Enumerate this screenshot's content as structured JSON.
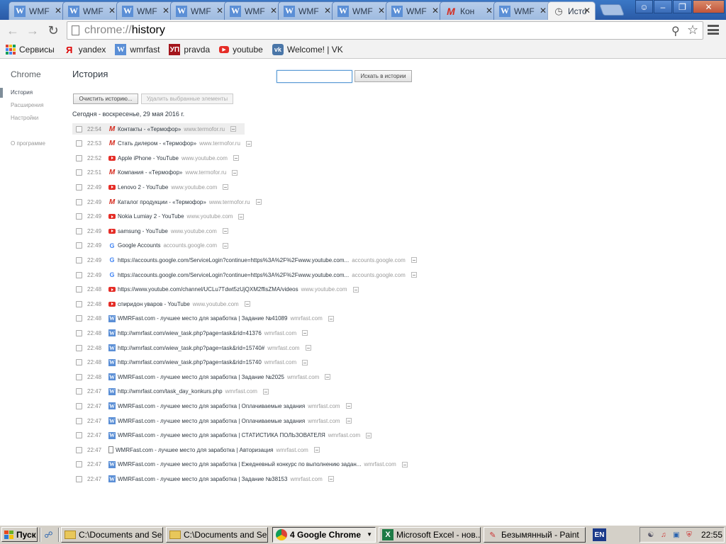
{
  "tabs": [
    {
      "title": "WMF",
      "icon": "wmrfast-favicon"
    },
    {
      "title": "WMF",
      "icon": "wmrfast-favicon"
    },
    {
      "title": "WMF",
      "icon": "wmrfast-favicon"
    },
    {
      "title": "WMF",
      "icon": "wmrfast-favicon"
    },
    {
      "title": "WMF",
      "icon": "wmrfast-favicon"
    },
    {
      "title": "WMF",
      "icon": "wmrfast-favicon"
    },
    {
      "title": "WMF",
      "icon": "wmrfast-favicon"
    },
    {
      "title": "WMF",
      "icon": "wmrfast-favicon"
    },
    {
      "title": "Кон",
      "icon": "termofor-favicon"
    },
    {
      "title": "WMF",
      "icon": "wmrfast-favicon"
    },
    {
      "title": "Исто",
      "icon": "history-clock-icon",
      "active": true
    }
  ],
  "omnibox": {
    "scheme": "chrome://",
    "host": "history"
  },
  "bookmarks": [
    {
      "label": "Сервисы",
      "icon": "apps-icon"
    },
    {
      "label": "yandex",
      "icon": "yandex-icon"
    },
    {
      "label": "wmrfast",
      "icon": "wmrfast-icon"
    },
    {
      "label": "pravda",
      "icon": "pravda-icon"
    },
    {
      "label": "youtube",
      "icon": "youtube-icon"
    },
    {
      "label": "Welcome! | VK",
      "icon": "vk-icon"
    }
  ],
  "sidebar": {
    "title": "Chrome",
    "items": [
      {
        "label": "История"
      },
      {
        "label": "Расширения"
      },
      {
        "label": "Настройки"
      },
      {
        "label": "О программе"
      }
    ]
  },
  "history": {
    "title": "История",
    "search_button": "Искать в истории",
    "clear_button": "Очистить историю...",
    "remove_button": "Удалить выбранные элементы",
    "day_header": "Сегодня - воскресенье, 29 мая 2016 г.",
    "entries": [
      {
        "time": "22:54",
        "icon": "termofor",
        "title": "Контакты - «Термофор»",
        "domain": "www.termofor.ru"
      },
      {
        "time": "22:53",
        "icon": "termofor",
        "title": "Стать дилером - «Термофор»",
        "domain": "www.termofor.ru"
      },
      {
        "time": "22:52",
        "icon": "youtube",
        "title": "Apple iPhone - YouTube",
        "domain": "www.youtube.com"
      },
      {
        "time": "22:51",
        "icon": "termofor",
        "title": "Компания - «Термофор»",
        "domain": "www.termofor.ru"
      },
      {
        "time": "22:49",
        "icon": "youtube",
        "title": "Lenovo 2 - YouTube",
        "domain": "www.youtube.com"
      },
      {
        "time": "22:49",
        "icon": "termofor",
        "title": "Каталог продукции - «Термофор»",
        "domain": "www.termofor.ru"
      },
      {
        "time": "22:49",
        "icon": "youtube",
        "title": "Nokia Lumiay 2 - YouTube",
        "domain": "www.youtube.com"
      },
      {
        "time": "22:49",
        "icon": "youtube",
        "title": "samsung - YouTube",
        "domain": "www.youtube.com"
      },
      {
        "time": "22:49",
        "icon": "google",
        "title": "Google Accounts",
        "domain": "accounts.google.com"
      },
      {
        "time": "22:49",
        "icon": "google",
        "title": "https://accounts.google.com/ServiceLogin?continue=https%3A%2F%2Fwww.youtube.com...",
        "domain": "accounts.google.com"
      },
      {
        "time": "22:49",
        "icon": "google",
        "title": "https://accounts.google.com/ServiceLogin?continue=https%3A%2F%2Fwww.youtube.com...",
        "domain": "accounts.google.com"
      },
      {
        "time": "22:48",
        "icon": "youtube",
        "title": "https://www.youtube.com/channel/UCLu7Tdwt5zUjQXM2ffisZMA/videos",
        "domain": "www.youtube.com"
      },
      {
        "time": "22:48",
        "icon": "youtube",
        "title": "спиридон уваров - YouTube",
        "domain": "www.youtube.com"
      },
      {
        "time": "22:48",
        "icon": "wmrfast",
        "title": "WMRFast.com - лучшее место для заработка | Задание №41089",
        "domain": "wmrfast.com"
      },
      {
        "time": "22:48",
        "icon": "wmrfast",
        "title": "http://wmrfast.com/wiew_task.php?page=task&rid=41376",
        "domain": "wmrfast.com"
      },
      {
        "time": "22:48",
        "icon": "wmrfast",
        "title": "http://wmrfast.com/wiew_task.php?page=task&rid=15740#",
        "domain": "wmrfast.com"
      },
      {
        "time": "22:48",
        "icon": "wmrfast",
        "title": "http://wmrfast.com/wiew_task.php?page=task&rid=15740",
        "domain": "wmrfast.com"
      },
      {
        "time": "22:48",
        "icon": "wmrfast",
        "title": "WMRFast.com - лучшее место для заработка | Задание №2025",
        "domain": "wmrfast.com"
      },
      {
        "time": "22:47",
        "icon": "wmrfast",
        "title": "http://wmrfast.com/task_day_konkurs.php",
        "domain": "wmrfast.com"
      },
      {
        "time": "22:47",
        "icon": "wmrfast",
        "title": "WMRFast.com - лучшее место для заработка | Оплачиваемые задания",
        "domain": "wmrfast.com"
      },
      {
        "time": "22:47",
        "icon": "wmrfast",
        "title": "WMRFast.com - лучшее место для заработка | Оплачиваемые задания",
        "domain": "wmrfast.com"
      },
      {
        "time": "22:47",
        "icon": "wmrfast",
        "title": "WMRFast.com - лучшее место для заработка | СТАТИСТИКА ПОЛЬЗОВАТЕЛЯ",
        "domain": "wmrfast.com"
      },
      {
        "time": "22:47",
        "icon": "page",
        "title": "WMRFast.com - лучшее место для заработка | Авторизация",
        "domain": "wmrfast.com"
      },
      {
        "time": "22:47",
        "icon": "wmrfast",
        "title": "WMRFast.com - лучшее место для заработка | Ежедневный конкурс по выполнению задан...",
        "domain": "wmrfast.com"
      },
      {
        "time": "22:47",
        "icon": "wmrfast",
        "title": "WMRFast.com - лучшее место для заработка | Задание №38153",
        "domain": "wmrfast.com"
      }
    ]
  },
  "taskbar": {
    "start_label": "Пуск",
    "tasks": [
      {
        "label": "C:\\Documents and Se...",
        "icon": "folder"
      },
      {
        "label": "C:\\Documents and Se...",
        "icon": "folder"
      },
      {
        "label": "4 Google Chrome",
        "icon": "chrome",
        "active": true
      },
      {
        "label": "Microsoft Excel - нов...",
        "icon": "excel"
      },
      {
        "label": "Безымянный - Paint",
        "icon": "paint"
      }
    ],
    "language": "EN",
    "clock": "22:55"
  }
}
